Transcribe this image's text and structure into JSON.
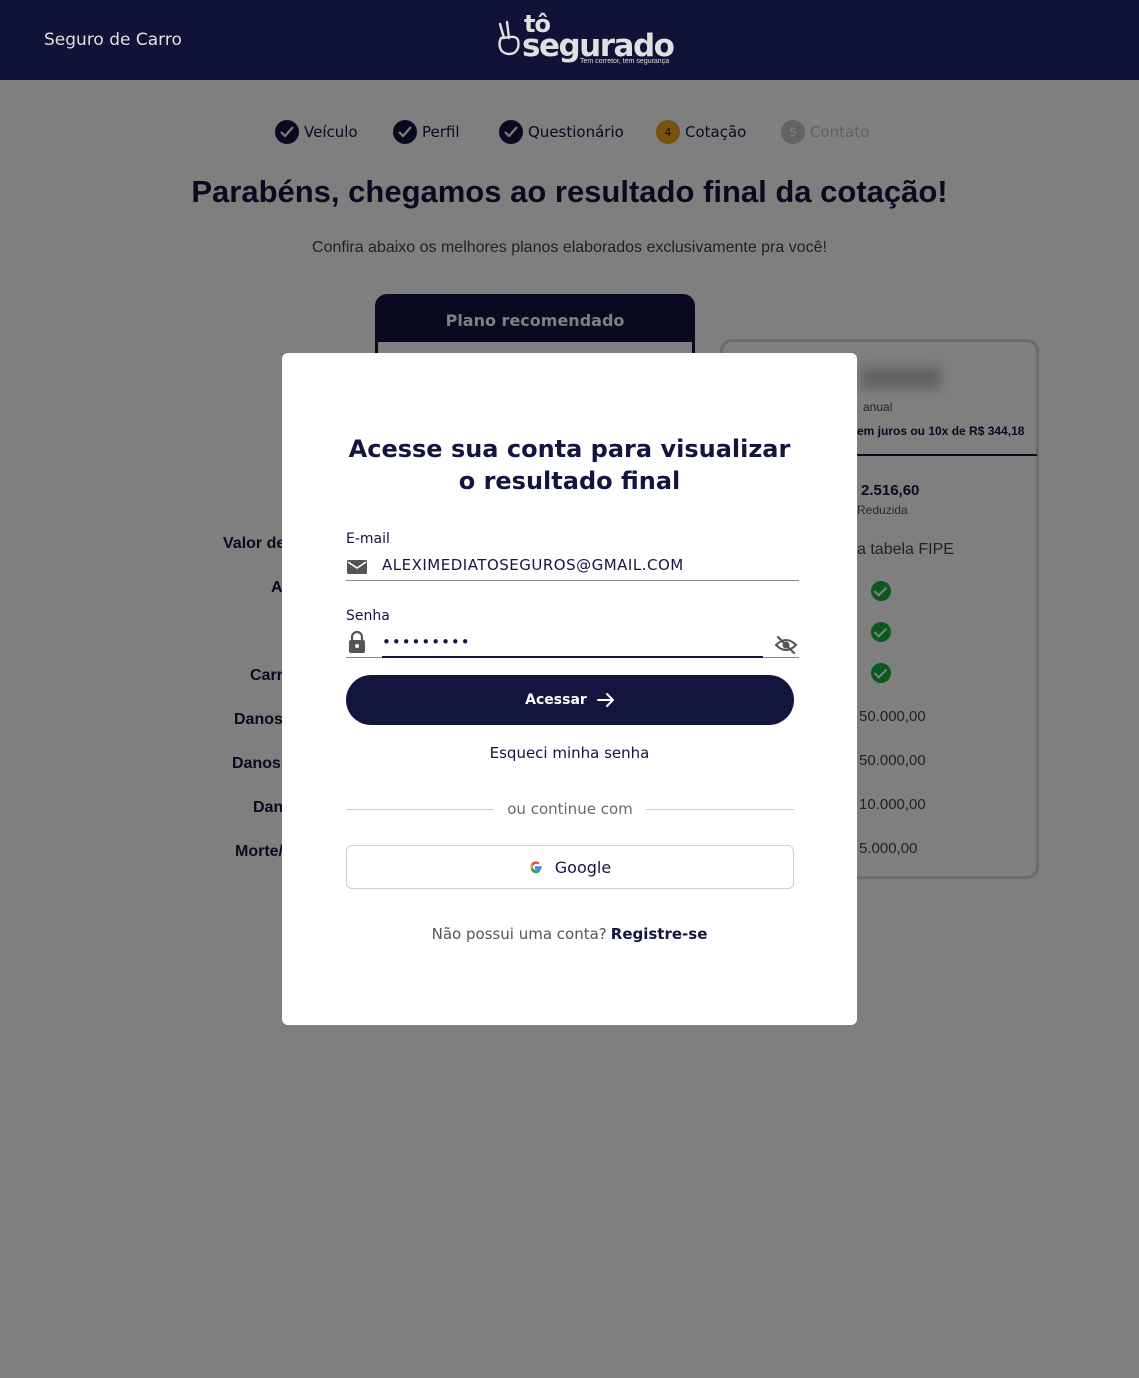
{
  "header": {
    "left_link": "Seguro de Carro",
    "logo_top": "tô",
    "logo_main": "segurado",
    "logo_tagline": "Tem corretor, tem segurança"
  },
  "stepper": {
    "steps": [
      {
        "label": "Veículo",
        "state": "done"
      },
      {
        "label": "Perfil",
        "state": "done"
      },
      {
        "label": "Questionário",
        "state": "done"
      },
      {
        "label": "Cotação",
        "number": "4",
        "state": "current"
      },
      {
        "label": "Contato",
        "number": "5",
        "state": "todo"
      }
    ]
  },
  "page": {
    "title": "Parabéns, chegamos ao resultado final da cotação!",
    "subtitle": "Confira abaixo os melhores planos elaborados exclusivamente pra você!"
  },
  "recommended_card": {
    "title": "Plano recomendado"
  },
  "plan_card": {
    "period": "anual",
    "installments": "em juros ou 10x de R$ 344,18",
    "deductible": "2.516,60",
    "deductible_type": "Reduzida",
    "fipe": "a tabela FIPE",
    "values": [
      "50.000,00",
      "50.000,00",
      "10.000,00",
      "5.000,00"
    ]
  },
  "background_labels": [
    "Valor de",
    "A",
    "Carr",
    "Danos",
    "Danos",
    "Dan",
    "Morte/"
  ],
  "modal": {
    "title": "Acesse sua conta para visualizar o resultado final",
    "email_label": "E-mail",
    "email_value": "ALEXIMEDIATOSEGUROS@GMAIL.COM",
    "password_label": "Senha",
    "password_value": "•••••••••",
    "submit_label": "Acessar",
    "forgot_label": "Esqueci minha senha",
    "divider_text": "ou continue com",
    "google_label": "Google",
    "register_prompt": "Não possui uma conta?",
    "register_link": "Registre-se"
  },
  "colors": {
    "navy": "#13153f",
    "accent": "#f5a81c",
    "success": "#1bb33a"
  }
}
